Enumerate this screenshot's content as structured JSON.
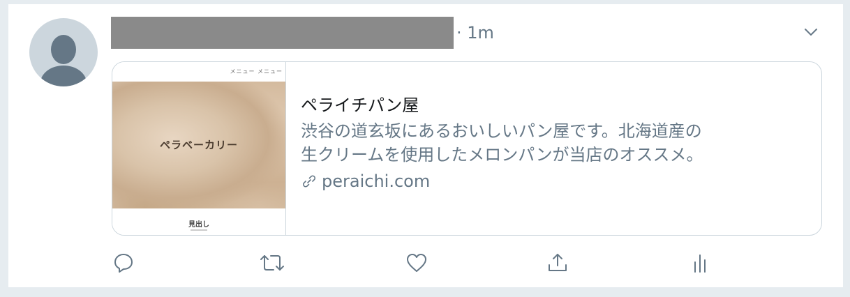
{
  "tweet": {
    "time": "· 1m",
    "card": {
      "thumb_menu": "メニュー メニュー",
      "thumb_title": "ペラベーカリー",
      "thumb_caption": "見出し",
      "title": "ペライチパン屋",
      "desc_line1": "渋谷の道玄坂にあるおいしいパン屋です。北海道産の",
      "desc_line2": "生クリームを使用したメロンパンが当店のオススメ。",
      "url": "peraichi.com"
    },
    "actions": [
      {
        "icon": "reply-icon"
      },
      {
        "icon": "retweet-icon"
      },
      {
        "icon": "like-icon"
      },
      {
        "icon": "share-icon"
      },
      {
        "icon": "analytics-icon"
      }
    ]
  },
  "colors": {
    "secondary_text": "#657786",
    "primary_text": "#14171a",
    "border": "#ccd6dd",
    "background": "#e6ecf0"
  }
}
